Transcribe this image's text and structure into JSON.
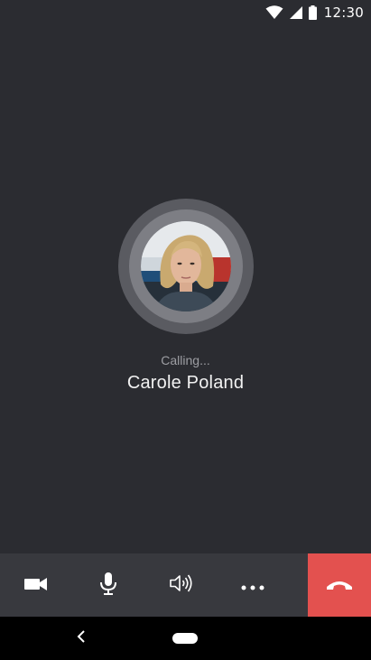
{
  "status_bar": {
    "time": "12:30",
    "icons": [
      "wifi-icon",
      "cell-signal-icon",
      "battery-icon"
    ]
  },
  "call": {
    "status": "Calling...",
    "caller_name": "Carole Poland",
    "avatar": "caller-photo"
  },
  "controls": {
    "items": [
      "video-camera-icon",
      "microphone-icon",
      "speaker-icon",
      "more-options-icon",
      "end-call-icon"
    ],
    "hangup_color": "#e3514f"
  },
  "nav": {
    "items": [
      "back-icon",
      "home-pill"
    ]
  },
  "colors": {
    "background": "#2b2c31",
    "control_bar": "#38393e",
    "end_call": "#e3514f"
  }
}
